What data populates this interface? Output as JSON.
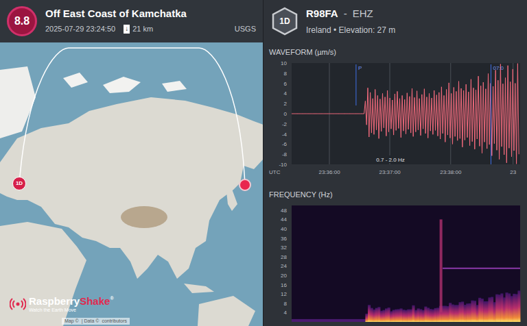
{
  "event": {
    "magnitude": "8.8",
    "title": "Off East Coast of Kamchatka",
    "time": "2025-07-29 23:24:50",
    "depth_icon": "↓",
    "depth": "21 km",
    "source": "USGS"
  },
  "map": {
    "station_pin": "1D",
    "logo": {
      "name_a": "Raspberry",
      "name_b": "Shake",
      "mark": "®",
      "tagline": "Watch the Earth Move"
    },
    "attribution": [
      "Map ©",
      "| Data ©",
      "contributors"
    ]
  },
  "station": {
    "badge": "1D",
    "code": "R98FA",
    "separator": "-",
    "channel": "EHZ",
    "location": "Ireland • Elevation: 27 m"
  },
  "waveform": {
    "title": "WAVEFORM (µm/s)",
    "y_ticks": [
      "10",
      "8",
      "6",
      "4",
      "2",
      "0",
      "-2",
      "-4",
      "-6",
      "-8",
      "-10"
    ],
    "y_range": [
      -10,
      10
    ],
    "x_range_s": [
      0,
      227
    ],
    "x_ticks": [
      {
        "label": "23:36:00",
        "t": 37.5
      },
      {
        "label": "23:37:00",
        "t": 97.5
      },
      {
        "label": "23:38:00",
        "t": 158
      },
      {
        "label": "23",
        "t": 220
      }
    ],
    "axis_unit": "UTC",
    "filter": "0.7 - 2.0 Hz",
    "phases": [
      {
        "label": "P",
        "t": 64,
        "full": false
      },
      {
        "label": "07:0",
        "t": 198,
        "full": true
      }
    ],
    "max": [
      0,
      0,
      0,
      0,
      0,
      0,
      0,
      0,
      0,
      0,
      0,
      0,
      0,
      0,
      0,
      0,
      0,
      0,
      0,
      0,
      0,
      0,
      0,
      0,
      0,
      0,
      0,
      0,
      0,
      0,
      2.5,
      5.1,
      4.2,
      3.0,
      4.8,
      3.6,
      2.9,
      4.0,
      3.3,
      4.6,
      3.1,
      2.7,
      3.9,
      4.4,
      3.0,
      3.6,
      2.8,
      4.1,
      3.4,
      5.0,
      3.2,
      4.5,
      3.0,
      3.8,
      4.9,
      3.3,
      4.0,
      3.1,
      4.6,
      3.7,
      4.2,
      5.3,
      3.6,
      4.8,
      6.1,
      4.0,
      5.2,
      4.4,
      6.4,
      5.0,
      4.6,
      5.8,
      4.3,
      6.8,
      5.1,
      4.7,
      7.4,
      5.5,
      6.2,
      4.9,
      7.9,
      6.0,
      5.4,
      8.6,
      6.6,
      9.8,
      5.9,
      7.1,
      9.5,
      6.3,
      8.8,
      6.0,
      9.9
    ],
    "min": [
      0,
      0,
      0,
      0,
      0,
      0,
      0,
      0,
      0,
      0,
      0,
      0,
      0,
      0,
      0,
      0,
      0,
      0,
      0,
      0,
      0,
      0,
      0,
      0,
      0,
      0,
      0,
      0,
      0,
      0,
      -2.2,
      -4.6,
      -3.8,
      -4.1,
      -3.2,
      -4.9,
      -3.5,
      -2.8,
      -4.4,
      -3.6,
      -3.0,
      -4.2,
      -3.3,
      -2.9,
      -4.7,
      -3.4,
      -4.0,
      -3.1,
      -3.8,
      -4.5,
      -3.6,
      -3.2,
      -4.3,
      -3.0,
      -3.9,
      -4.8,
      -3.4,
      -4.1,
      -3.3,
      -4.4,
      -5.0,
      -3.9,
      -5.6,
      -4.2,
      -4.8,
      -6.0,
      -4.5,
      -5.3,
      -4.9,
      -6.6,
      -5.2,
      -4.7,
      -6.3,
      -5.5,
      -7.0,
      -5.0,
      -6.4,
      -7.8,
      -5.6,
      -6.9,
      -6.1,
      -8.3,
      -5.9,
      -7.2,
      -9.0,
      -6.5,
      -8.1,
      -9.7,
      -6.8,
      -8.5,
      -7.3,
      -9.9,
      -8.0
    ]
  },
  "spectrogram": {
    "title": "FREQUENCY (Hz)",
    "y_ticks": [
      "48",
      "44",
      "40",
      "36",
      "32",
      "28",
      "24",
      "20",
      "16",
      "12",
      "8",
      "4"
    ],
    "y_range": [
      0,
      50
    ],
    "features": [
      {
        "kind": "vertical",
        "t": 147,
        "hz": [
          4,
          44
        ]
      },
      {
        "kind": "horizontal",
        "t": [
          150,
          227
        ],
        "hz": [
          23,
          23
        ]
      }
    ]
  }
}
